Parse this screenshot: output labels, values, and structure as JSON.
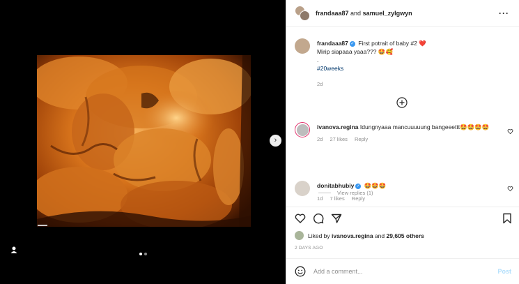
{
  "header": {
    "user1": "frandaaa87",
    "and_text": "and",
    "user2": "samuel_zylgwyn",
    "more_icon": "more-horizontal-icon"
  },
  "caption": {
    "username": "frandaaa87",
    "text_line1": "First potrait of baby #2 ❤️",
    "text_line2": "Mirip siapaaa yaaa??? 🤩🥰",
    "text_line3": ".",
    "hashtag": "#20weeks",
    "time": "2d"
  },
  "comments": [
    {
      "username": "ivanova.regina",
      "text": "Idungnyaaa mancuuuuung bangeeettt🤩🤩🤩🤩",
      "time": "2d",
      "likes": "27 likes",
      "reply": "Reply",
      "view_replies": "View replies (1)"
    },
    {
      "username": "donitabhubiy",
      "text": "🤩🤩🤩",
      "time": "1d",
      "likes": "7 likes",
      "reply": "Reply"
    }
  ],
  "liked_by": {
    "prefix": "Liked by",
    "user": "ivanova.regina",
    "and_text": "and",
    "others": "29,605 others"
  },
  "time_ago": "2 DAYS AGO",
  "add_comment": {
    "placeholder": "Add a comment...",
    "post_label": "Post"
  },
  "colors": {
    "accent": "#3897f0",
    "like_red": "#ed4956",
    "hashtag": "#00376b",
    "muted": "#8e8e8e"
  },
  "icons": [
    "heart-icon",
    "comment-icon",
    "share-icon",
    "bookmark-icon",
    "emoji-icon",
    "next-arrow-icon",
    "user-tag-icon",
    "add-circle-icon",
    "verified-badge-icon"
  ],
  "media": {
    "carousel_count": 2,
    "carousel_active": 1
  }
}
